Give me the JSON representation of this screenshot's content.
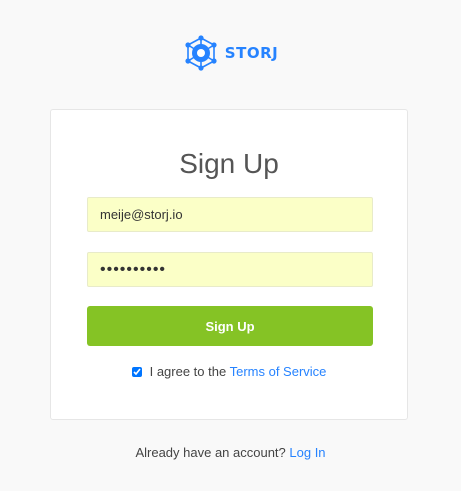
{
  "brand": {
    "name": "STORJ",
    "icon": "storj-logo-icon",
    "color": "#2683ff"
  },
  "signup": {
    "title": "Sign Up",
    "email_value": "meije@storj.io",
    "password_value": "password12",
    "submit_label": "Sign Up",
    "agree_text": "I agree to the ",
    "terms_link": "Terms of Service",
    "agree_checked": true
  },
  "footer": {
    "prompt": "Already have an account? ",
    "login_link": "Log In"
  },
  "colors": {
    "accent": "#85c325",
    "link": "#2683ff",
    "field_bg": "#fbffc7"
  }
}
